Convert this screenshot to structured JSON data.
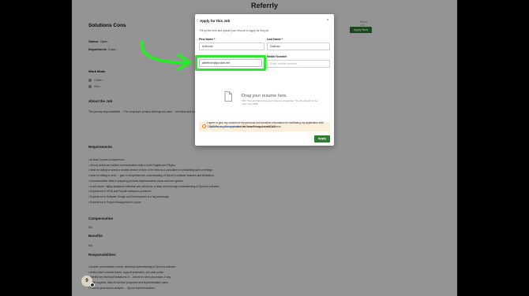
{
  "site": {
    "title": "Referrly"
  },
  "job": {
    "title": "Solutions Cons",
    "share": "Share Job",
    "apply_now": "Apply Now",
    "status_label": "Status:",
    "status_value": "Open",
    "department_label": "Department:",
    "department_value": "Cons...",
    "work_mode_label": "Work Mode",
    "work_mode_items": [
      "Onsite ...",
      "Rem..."
    ],
    "about_heading": "About the Job",
    "about_text": "The primary responsibilities ... The company's product offerings are used ... technical and business requirements ... implementation schemes ...",
    "requirements_heading": "Requirements",
    "requirements": [
      "At least 3 years of experience ...",
      "Strong verbal and written communication skills in both English and Filipino.",
      "Must be willing to spend a sizable amount of time in the field as a consultant in onboarding sales meetings.",
      "Must be willing to work ... gain a comprehensive understanding of Sprout's software features and limitations.",
      "Documentation skills in preparing process implementation plans and user guides.",
      "A self-driven, highly-analytical individual who strives for a deep and thorough understanding of Sprout's software.",
      "Experience in HRIS and Payroll software is preferred.",
      "Experience in Software Design and Development is a big advantage.",
      "Experience in Project Management is a plus."
    ],
    "compensation_heading": "Compensation",
    "compensation_value": "NA",
    "benefits_heading": "Benefits",
    "benefits_value": "NA",
    "responsibilities_heading": "Responsibilities",
    "responsibilities": [
      "Acquire and maintain a deep, technical understanding of Sprout's software.",
      "Assist client success teams, support processes, and pain points.",
      "Identify key technical limitations of ... based on client processes, if any.",
      "Draft targeted, tailor-fit solution proposals and implementation plans.",
      "Perform post-launch analysis ... Sprout implementations."
    ]
  },
  "modal": {
    "title": "Apply for this Job",
    "close": "×",
    "subtitle": "Fill up the form and upload your resume to apply for this job.",
    "first_name_label": "First Name *",
    "first_name_value": "Anthone",
    "last_name_label": "Last Name *",
    "last_name_value": "Dakhan",
    "email_value": "adietrich@proton.me",
    "mobile_label": "Mobile Number",
    "mobile_placeholder": "Enter mobile number",
    "upload_title": "Drag your resume here.",
    "upload_sub": "PDF, Text and Word document files are supported. The file should not be more than 3MB.",
    "notice": "Updates on your application will be sent to your email address.",
    "consent_before": "I agree to give my consent to my personal and sensitive information for facilitating my application with ",
    "consent_link": "CDMS Privacy Statement",
    "consent_after": " and the Data Privacy Act of 2012.",
    "apply_label": "Apply"
  },
  "user": {
    "avatar_initial": "9"
  },
  "colors": {
    "highlight": "#2ee62e",
    "arrow": "#2ee62e",
    "primary": "#2e7d32"
  }
}
